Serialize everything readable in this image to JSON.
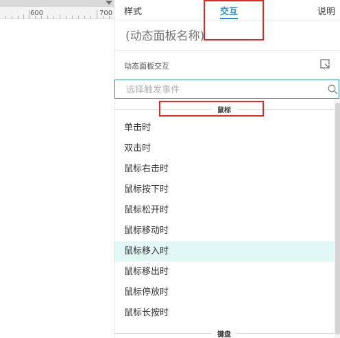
{
  "ruler": {
    "labels": [
      "600",
      "700"
    ]
  },
  "tabs": {
    "style_label": "样式",
    "interaction_label": "交互",
    "notes_label": "说明",
    "active": "interaction"
  },
  "panel": {
    "name_placeholder": "(动态面板名称)",
    "section_label": "动态面板交互",
    "search_placeholder": "选择触发事件"
  },
  "groups": {
    "mouse_label": "鼠标",
    "keyboard_label": "键盘"
  },
  "events": [
    {
      "label": "单击时"
    },
    {
      "label": "双击时"
    },
    {
      "label": "鼠标右击时"
    },
    {
      "label": "鼠标按下时"
    },
    {
      "label": "鼠标松开时"
    },
    {
      "label": "鼠标移动时"
    },
    {
      "label": "鼠标移入时",
      "highlighted": true
    },
    {
      "label": "鼠标移出时"
    },
    {
      "label": "鼠标停放时"
    },
    {
      "label": "鼠标长按时"
    }
  ],
  "colors": {
    "accent": "#1f8ce0",
    "highlight_row": "#e0f7f6",
    "annotation_red": "#e8261f",
    "search_border": "#3d8fd1"
  },
  "icons": [
    "expand-icon",
    "search-icon",
    "scroll-arrow-icon"
  ]
}
